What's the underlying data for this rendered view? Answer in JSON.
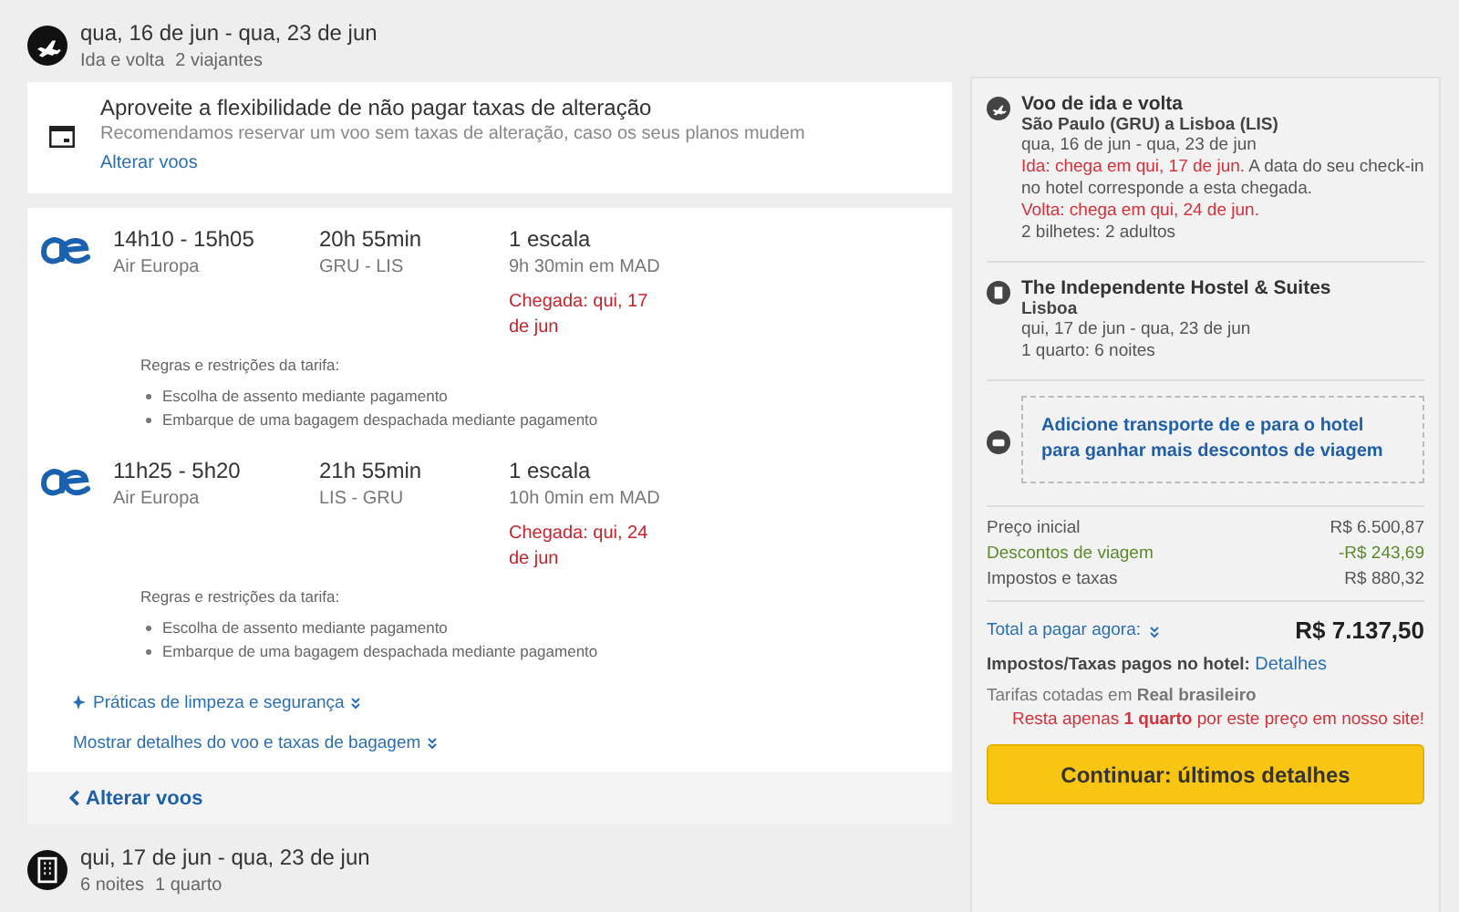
{
  "trip_header": {
    "title": "qua, 16 de jun - qua, 23 de jun",
    "details": [
      "Ida e volta",
      "2 viajantes"
    ]
  },
  "flex_notice": {
    "title": "Aproveite a flexibilidade de não pagar taxas de alteração",
    "text": "Recomendamos reservar um voo sem taxas de alteração, caso os seus planos mudem",
    "link": "Alterar voos"
  },
  "flights": [
    {
      "times": "14h10 - 15h05",
      "airline": "Air Europa",
      "duration": "20h 55min",
      "route": "GRU - LIS",
      "stops": "1 escala",
      "layover": "9h 30min em MAD",
      "arrival": "Chegada: qui, 17 de jun",
      "rules_title": "Regras e restrições da tarifa:",
      "rules": [
        "Escolha de assento mediante pagamento",
        "Embarque de uma bagagem despachada mediante pagamento"
      ]
    },
    {
      "times": "11h25 - 5h20",
      "airline": "Air Europa",
      "duration": "21h 55min",
      "route": "LIS - GRU",
      "stops": "1 escala",
      "layover": "10h 0min em MAD",
      "arrival": "Chegada: qui, 24 de jun",
      "rules_title": "Regras e restrições da tarifa:",
      "rules": [
        "Escolha de assento mediante pagamento",
        "Embarque de uma bagagem despachada mediante pagamento"
      ]
    }
  ],
  "cleaning_link": "Práticas de limpeza e segurança",
  "details_link": "Mostrar detalhes do voo e taxas de bagagem",
  "back_link": "Alterar voos",
  "hotel_header": {
    "title": "qui, 17 de jun - qua, 23 de jun",
    "details": [
      "6 noites",
      "1 quarto"
    ]
  },
  "summary": {
    "flight": {
      "title": "Voo de ida e volta",
      "route": "São Paulo (GRU) a Lisboa (LIS)",
      "dates": "qua, 16 de jun - qua, 23 de jun",
      "outbound_alert": "Ida: chega em qui, 17 de jun.",
      "outbound_note": "A data do seu check-in no hotel corresponde a esta chegada.",
      "return_alert": "Volta: chega em qui, 24 de jun.",
      "tickets": "2 bilhetes: 2 adultos"
    },
    "hotel": {
      "name": "The Independente Hostel & Suites",
      "city": "Lisboa",
      "dates": "qui, 17 de jun - qua, 23 de jun",
      "rooms": "1 quarto: 6 noites"
    },
    "promo": "Adicione transporte de e para o hotel para ganhar mais descontos de viagem",
    "prices": [
      {
        "label": "Preço inicial",
        "amount": "R$ 6.500,87",
        "kind": "normal"
      },
      {
        "label": "Descontos de viagem",
        "amount": "-R$ 243,69",
        "kind": "discount"
      },
      {
        "label": "Impostos e taxas",
        "amount": "R$ 880,32",
        "kind": "normal"
      }
    ],
    "total": {
      "label": "Total a pagar agora:",
      "amount": "R$ 7.137,50"
    },
    "hotel_taxes": {
      "label": "Impostos/Taxas pagos no hotel:",
      "link": "Detalhes"
    },
    "currency": "Tarifas cotadas em **Real brasileiro**",
    "availability": "Resta apenas **1 quarto** por este preço em nosso site!",
    "continue_button": "Continuar: últimos detalhes"
  }
}
